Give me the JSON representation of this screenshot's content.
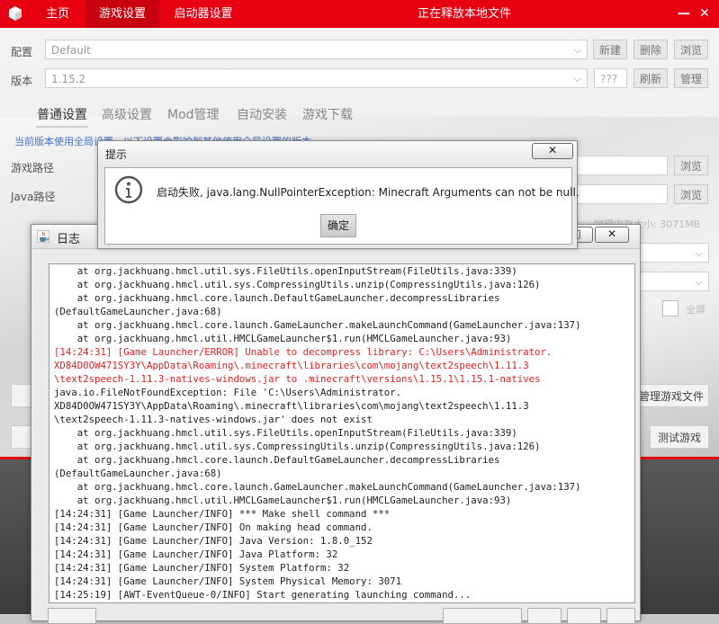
{
  "topbar": {
    "tabs": [
      {
        "label": "主页"
      },
      {
        "label": "游戏设置"
      },
      {
        "label": "启动器设置"
      }
    ],
    "status_title": "正在释放本地文件",
    "minimize_glyph": "—",
    "close_glyph": "✕"
  },
  "profile": {
    "label": "配置",
    "value": "Default",
    "new_button": "新建",
    "delete_button": "删除",
    "browse_button": "浏览"
  },
  "version": {
    "label": "版本",
    "value": "1.15.2",
    "extra_field": "???",
    "refresh_button": "刷新",
    "manage_button": "管理"
  },
  "settings_tabs": [
    {
      "label": "普通设置"
    },
    {
      "label": "高级设置"
    },
    {
      "label": "Mod管理"
    },
    {
      "label": "自动安装"
    },
    {
      "label": "游戏下载"
    }
  ],
  "hint_text": "当前版本使用全局设置，以下设置会影响到其他使用全局设置的版本",
  "game_path": {
    "label": "游戏路径",
    "browse_button": "浏览"
  },
  "java_path": {
    "label": "Java路径",
    "browse_button": "浏览"
  },
  "memory_text": "物理内存大小: 3071MB",
  "fullscreen_label": "全屏",
  "manage_game_files_button": "管理游戏文件",
  "test_game_button": "测试游戏",
  "log_window": {
    "title": "日志",
    "lines": [
      {
        "text": "    at org.jackhuang.hmcl.util.sys.FileUtils.openInputStream(FileUtils.java:339)",
        "error": false
      },
      {
        "text": "    at org.jackhuang.hmcl.util.sys.CompressingUtils.unzip(CompressingUtils.java:126)",
        "error": false
      },
      {
        "text": "    at org.jackhuang.hmcl.core.launch.DefaultGameLauncher.decompressLibraries",
        "error": false
      },
      {
        "text": "(DefaultGameLauncher.java:68)",
        "error": false
      },
      {
        "text": "    at org.jackhuang.hmcl.core.launch.GameLauncher.makeLaunchCommand(GameLauncher.java:137)",
        "error": false
      },
      {
        "text": "    at org.jackhuang.hmcl.util.HMCLGameLauncher$1.run(HMCLGameLauncher.java:93)",
        "error": false
      },
      {
        "text": "[14:24:31] [Game Launcher/ERROR] Unable to decompress library: C:\\Users\\Administrator.",
        "error": true
      },
      {
        "text": "XD84D0OW471SY3Y\\AppData\\Roaming\\.minecraft\\libraries\\com\\mojang\\text2speech\\1.11.3",
        "error": true
      },
      {
        "text": "\\text2speech-1.11.3-natives-windows.jar to .minecraft\\versions\\1.15.1\\1.15.1-natives",
        "error": true
      },
      {
        "text": "java.io.FileNotFoundException: File 'C:\\Users\\Administrator.",
        "error": false
      },
      {
        "text": "XD84D0OW471SY3Y\\AppData\\Roaming\\.minecraft\\libraries\\com\\mojang\\text2speech\\1.11.3",
        "error": false
      },
      {
        "text": "\\text2speech-1.11.3-natives-windows.jar' does not exist",
        "error": false
      },
      {
        "text": "    at org.jackhuang.hmcl.util.sys.FileUtils.openInputStream(FileUtils.java:339)",
        "error": false
      },
      {
        "text": "    at org.jackhuang.hmcl.util.sys.CompressingUtils.unzip(CompressingUtils.java:126)",
        "error": false
      },
      {
        "text": "    at org.jackhuang.hmcl.core.launch.DefaultGameLauncher.decompressLibraries",
        "error": false
      },
      {
        "text": "(DefaultGameLauncher.java:68)",
        "error": false
      },
      {
        "text": "    at org.jackhuang.hmcl.core.launch.GameLauncher.makeLaunchCommand(GameLauncher.java:137)",
        "error": false
      },
      {
        "text": "    at org.jackhuang.hmcl.util.HMCLGameLauncher$1.run(HMCLGameLauncher.java:93)",
        "error": false
      },
      {
        "text": "[14:24:31] [Game Launcher/INFO] *** Make shell command ***",
        "error": false
      },
      {
        "text": "[14:24:31] [Game Launcher/INFO] On making head command.",
        "error": false
      },
      {
        "text": "[14:24:31] [Game Launcher/INFO] Java Version: 1.8.0_152",
        "error": false
      },
      {
        "text": "[14:24:31] [Game Launcher/INFO] Java Platform: 32",
        "error": false
      },
      {
        "text": "[14:24:31] [Game Launcher/INFO] System Platform: 32",
        "error": false
      },
      {
        "text": "[14:24:31] [Game Launcher/INFO] System Physical Memory: 3071",
        "error": false
      },
      {
        "text": "[14:25:19] [AWT-EventQueue-0/INFO] Start generating launching command...",
        "error": false
      }
    ]
  },
  "alert": {
    "title": "提示",
    "close_glyph": "✕",
    "message": "启动失败, java.lang.NullPointerException: Minecraft Arguments can not be null.",
    "ok_button": "确定"
  }
}
